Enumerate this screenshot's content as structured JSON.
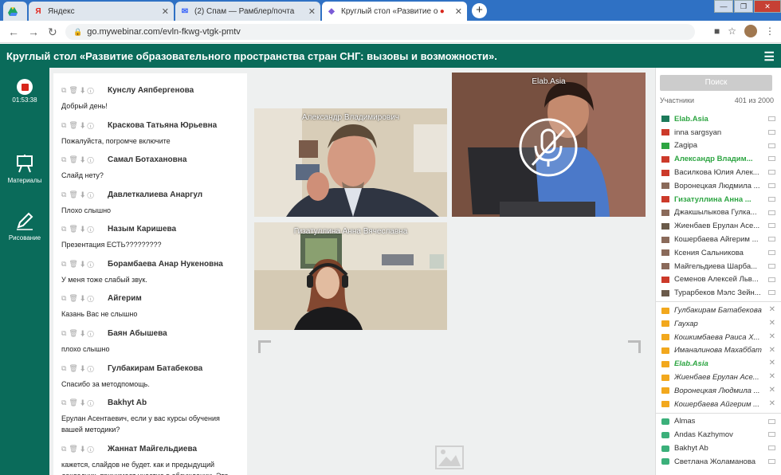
{
  "browser": {
    "tabs": [
      {
        "title": "Яндекс",
        "favicon": "Я"
      },
      {
        "title": "(2) Спам — Рамблер/почта",
        "favicon": "✉"
      },
      {
        "title": "Круглый стол «Развитие об",
        "favicon": "●"
      }
    ],
    "new_tab": "+",
    "url": "go.mywebinar.com/evln-fkwg-vtgk-pmtv"
  },
  "app": {
    "title": "Круглый стол «Развитие образовательного пространства стран СНГ: вызовы и возможности».",
    "timer": "01:53:38",
    "rail": {
      "materials": "Материалы",
      "drawing": "Рисование"
    }
  },
  "chat": [
    {
      "who": "Кунслу Аяпбергенова",
      "text": "Добрый день!"
    },
    {
      "who": "Краскова Татьяна Юрьевна",
      "text": "Пожалуйста, погромче включите"
    },
    {
      "who": "Самал Ботахановна",
      "text": "Слайд нету?"
    },
    {
      "who": "Давлеткалиева Анаргул",
      "text": "Плохо слышно"
    },
    {
      "who": "Назым Каришева",
      "text": "Презентация ЕСТЬ?????????"
    },
    {
      "who": "Борамбаева Анар Нукеновна",
      "text": "У меня тоже слабый звук."
    },
    {
      "who": "Айгерим",
      "text": "Казань Вас не слышно"
    },
    {
      "who": "Баян Абышева",
      "text": "плохо слышно"
    },
    {
      "who": "Гулбакирам Батабекова",
      "text": "Спасибо за методпомощь."
    },
    {
      "who": "Bakhyt Ab",
      "text": "Ерулан Асентаевич, если у вас курсы обучения вашей методики?"
    },
    {
      "who": "Жаннат Майгельдиева",
      "text": "кажется, слайдов не будет. как и предыдущий докладчик, принимает участие в обсуждении. Это"
    }
  ],
  "videos": {
    "v1": "Александр Владимирович",
    "v2": "Elab.Asia",
    "v3": "Гизатуллина Анна Вячеславна"
  },
  "participants": {
    "search_placeholder": "Поиск",
    "header": "Участники",
    "count": "401 из 2000",
    "presenters": [
      {
        "name": "Elab.Asia",
        "green": true
      },
      {
        "name": "inna sargsyan",
        "green": false
      },
      {
        "name": "Zagipa",
        "green": false
      },
      {
        "name": "Александр Владим...",
        "green": true
      },
      {
        "name": "Василкова Юлия Алек...",
        "green": false
      },
      {
        "name": "Воронецкая Людмила ...",
        "green": false
      },
      {
        "name": "Гизатуллина Анна ...",
        "green": true
      },
      {
        "name": "Джакшылыкова Гулка...",
        "green": false
      },
      {
        "name": "Жиенбаев Ерулан Асе...",
        "green": false
      },
      {
        "name": "Кошербаева Айгерим ...",
        "green": false
      },
      {
        "name": "Ксения Сальникова",
        "green": false
      },
      {
        "name": "Майгельдиева Шарба...",
        "green": false
      },
      {
        "name": "Семенов Алексей Льв...",
        "green": false
      },
      {
        "name": "Турарбеков Мэлс Зейн...",
        "green": false
      }
    ],
    "invited": [
      {
        "name": "Гулбакирам Батабекова",
        "green": false
      },
      {
        "name": "Гаухар",
        "green": false
      },
      {
        "name": "Кошкимбаева Раиса Х...",
        "green": false
      },
      {
        "name": "Иманалинова Махаббат",
        "green": false
      },
      {
        "name": "Elab.Asia",
        "green": true
      },
      {
        "name": "Жиенбаев Ерулан Асе...",
        "green": false
      },
      {
        "name": "Воронецкая Людмила ...",
        "green": false
      },
      {
        "name": "Кошербаева Айгерим ...",
        "green": false
      }
    ],
    "attendees": [
      {
        "name": "Almas"
      },
      {
        "name": "Andas Kazhymov"
      },
      {
        "name": "Bakhyt Ab"
      },
      {
        "name": "Светлана Жоламанова"
      }
    ]
  },
  "colors": {
    "brand": "#0a6b5a",
    "active_name": "#2da542",
    "record": "#d8261b"
  }
}
